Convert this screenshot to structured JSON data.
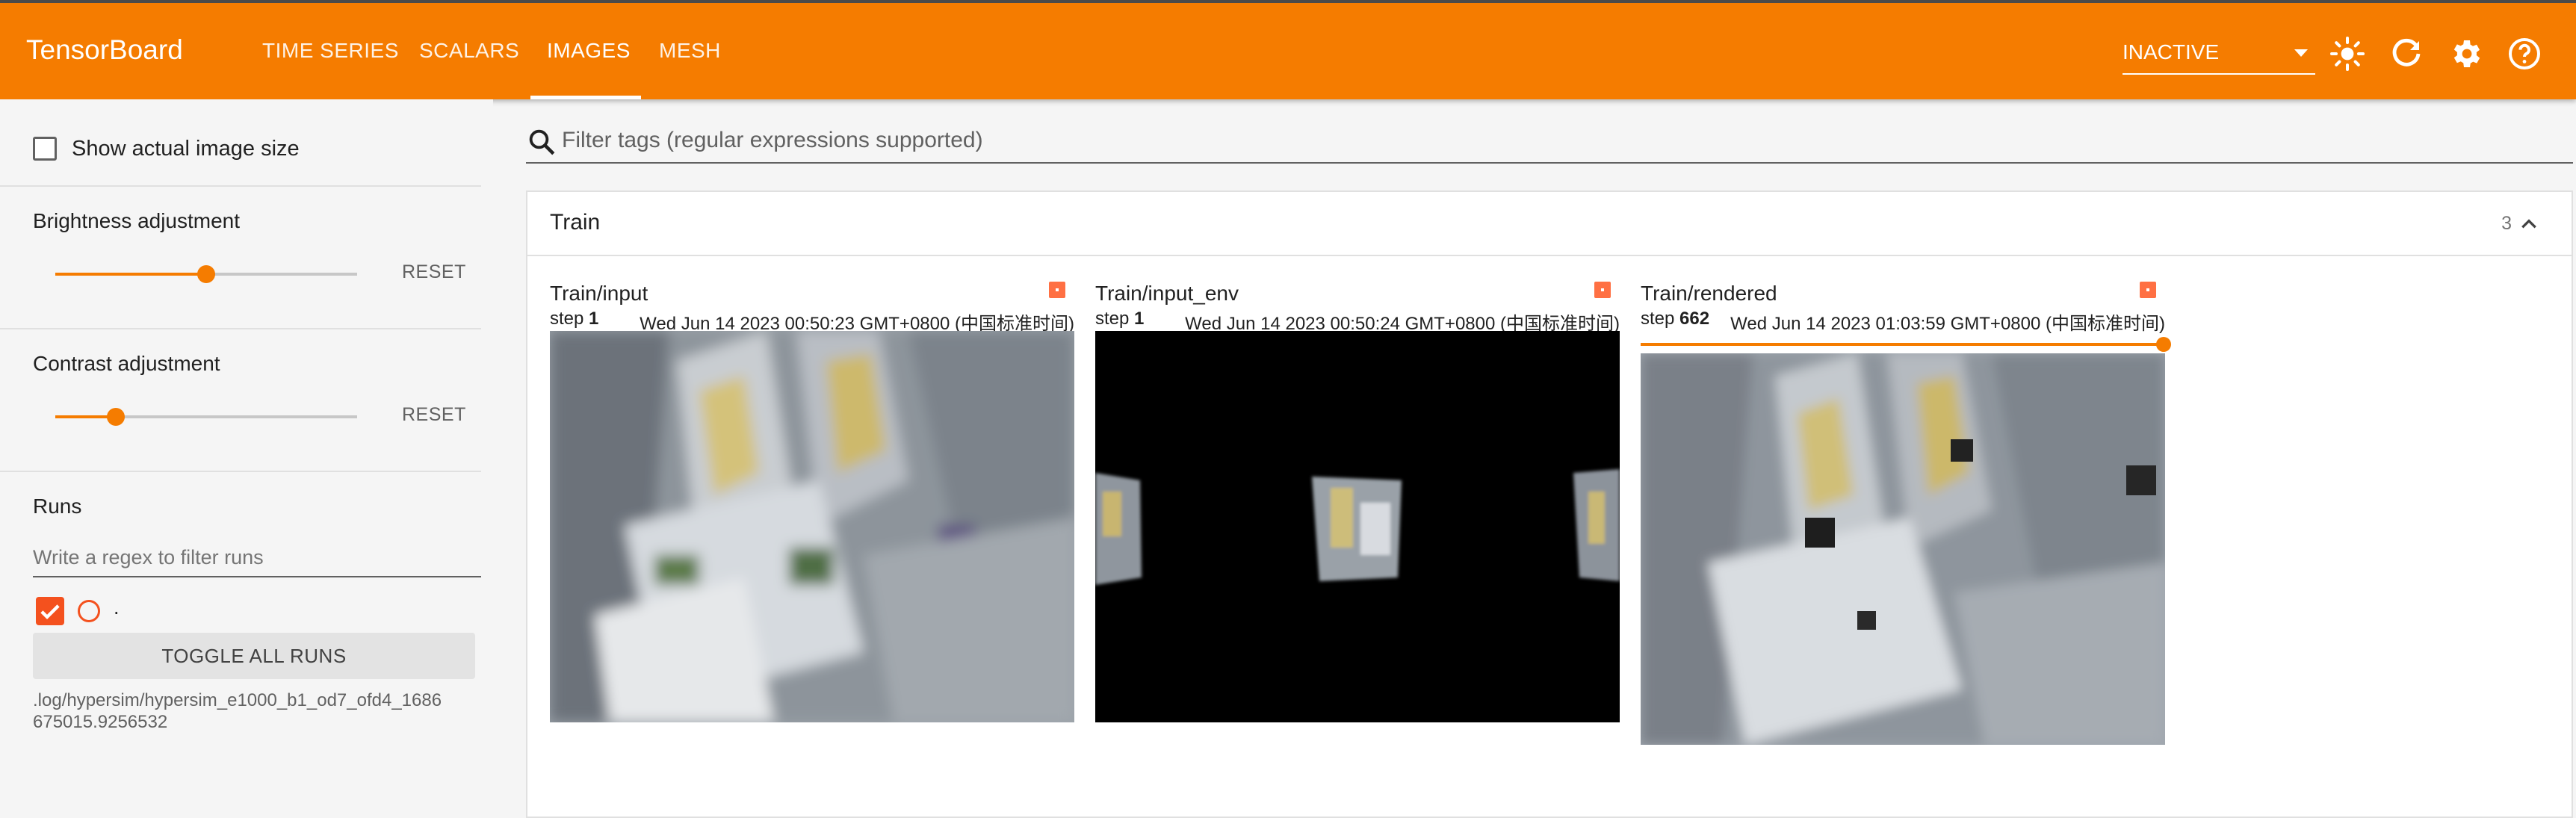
{
  "header": {
    "brand": "TensorBoard",
    "tabs": [
      {
        "label": "TIME SERIES"
      },
      {
        "label": "SCALARS"
      },
      {
        "label": "IMAGES",
        "active": true
      },
      {
        "label": "MESH"
      }
    ],
    "status_select": "INACTIVE",
    "icons": [
      "brightness-icon",
      "refresh-icon",
      "settings-icon",
      "help-icon"
    ]
  },
  "sidebar": {
    "show_actual_size_label": "Show actual image size",
    "show_actual_size_checked": false,
    "brightness": {
      "heading": "Brightness adjustment",
      "reset": "RESET",
      "level": 0.5
    },
    "contrast": {
      "heading": "Contrast adjustment",
      "reset": "RESET",
      "level": 0.2
    },
    "runs": {
      "heading": "Runs",
      "filter_placeholder": "Write a regex to filter runs",
      "run_name": ".",
      "run_checked": true,
      "toggle_label": "TOGGLE ALL RUNS",
      "run_path": ".log/hypersim/hypersim_e1000_b1_od7_ofd4_1686675015.9256532"
    }
  },
  "main": {
    "filter_placeholder": "Filter tags (regular expressions supported)",
    "group": {
      "title": "Train",
      "count": "3",
      "images": [
        {
          "title": "Train/input",
          "step_label": "step",
          "step": "1",
          "time": "Wed Jun 14 2023 00:50:23 GMT+0800 (中国标准时间)"
        },
        {
          "title": "Train/input_env",
          "step_label": "step",
          "step": "1",
          "time": "Wed Jun 14 2023 00:50:24 GMT+0800 (中国标准时间)"
        },
        {
          "title": "Train/rendered",
          "step_label": "step",
          "step": "662",
          "time": "Wed Jun 14 2023 01:03:59 GMT+0800 (中国标准时间)",
          "step_slider_level": 1.0
        }
      ]
    }
  },
  "colors": {
    "accent": "#f57c00",
    "run_color": "#f4511e"
  }
}
